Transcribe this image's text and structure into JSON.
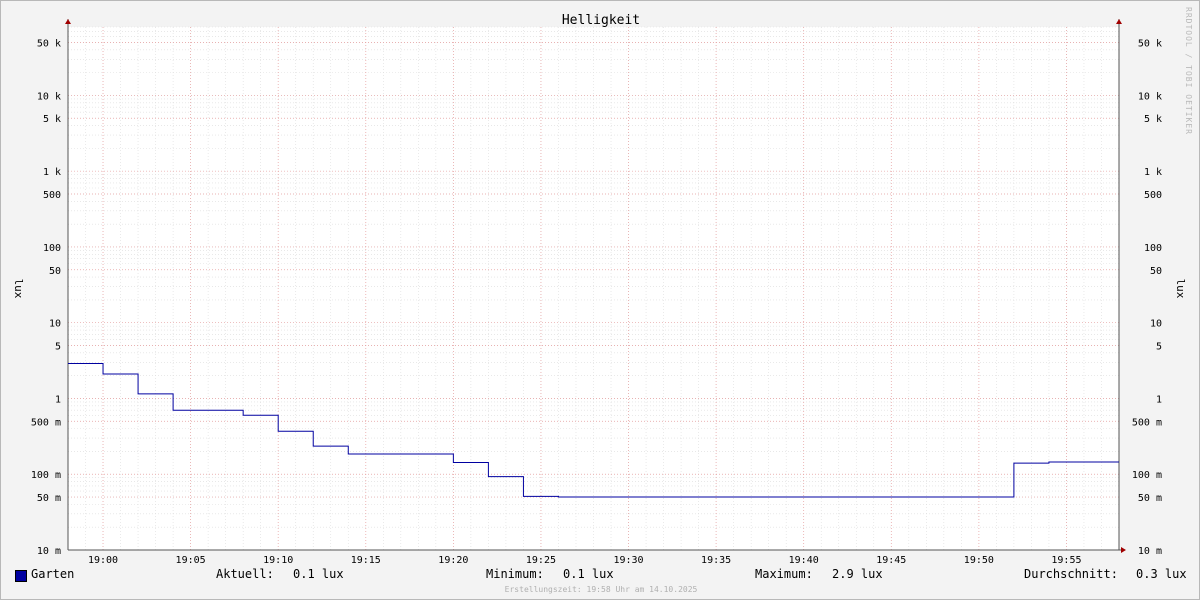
{
  "watermark": "RRDTOOL / TOBI OETIKER",
  "chart_data": {
    "type": "line",
    "title": "Helligkeit",
    "ylabel": "lux",
    "ylabel_right": "lux",
    "y_scale": "log",
    "ylim": [
      0.01,
      80000
    ],
    "x_start": "18:58",
    "x_end": "19:58",
    "x_ticks": [
      "19:00",
      "19:05",
      "19:10",
      "19:15",
      "19:20",
      "19:25",
      "19:30",
      "19:35",
      "19:40",
      "19:45",
      "19:50",
      "19:55"
    ],
    "y_ticks": [
      {
        "value": 50000,
        "label": "50 k"
      },
      {
        "value": 10000,
        "label": "10 k"
      },
      {
        "value": 5000,
        "label": "5 k"
      },
      {
        "value": 1000,
        "label": "1 k"
      },
      {
        "value": 500,
        "label": "500"
      },
      {
        "value": 100,
        "label": "100"
      },
      {
        "value": 50,
        "label": "50"
      },
      {
        "value": 10,
        "label": "10"
      },
      {
        "value": 5,
        "label": "5"
      },
      {
        "value": 1,
        "label": "1"
      },
      {
        "value": 0.5,
        "label": "500 m"
      },
      {
        "value": 0.1,
        "label": "100 m"
      },
      {
        "value": 0.05,
        "label": "50 m"
      },
      {
        "value": 0.01,
        "label": "10 m"
      }
    ],
    "grid": true,
    "legend_position": "bottom-left",
    "series": [
      {
        "name": "Garten",
        "color": "#0000a0",
        "step": true,
        "points": [
          {
            "x": "18:58",
            "y": 2.9
          },
          {
            "x": "19:00",
            "y": 2.1
          },
          {
            "x": "19:02",
            "y": 1.15
          },
          {
            "x": "19:04",
            "y": 0.7
          },
          {
            "x": "19:08",
            "y": 0.6
          },
          {
            "x": "19:10",
            "y": 0.37
          },
          {
            "x": "19:12",
            "y": 0.235
          },
          {
            "x": "19:14",
            "y": 0.185
          },
          {
            "x": "19:20",
            "y": 0.143
          },
          {
            "x": "19:22",
            "y": 0.093
          },
          {
            "x": "19:24",
            "y": 0.051
          },
          {
            "x": "19:26",
            "y": 0.05
          },
          {
            "x": "19:52",
            "y": 0.14
          },
          {
            "x": "19:54",
            "y": 0.145
          },
          {
            "x": "19:58",
            "y": 0.145
          }
        ]
      }
    ]
  },
  "legend": {
    "series_name": "Garten",
    "current_label": "Aktuell:",
    "current_value": "0.1 lux",
    "min_label": "Minimum:",
    "min_value": "0.1 lux",
    "max_label": "Maximum:",
    "max_value": "2.9 lux",
    "avg_label": "Durchschnitt:",
    "avg_value": "0.3 lux"
  },
  "footer": "Erstellungszeit: 19:58 Uhr am 14.10.2025"
}
